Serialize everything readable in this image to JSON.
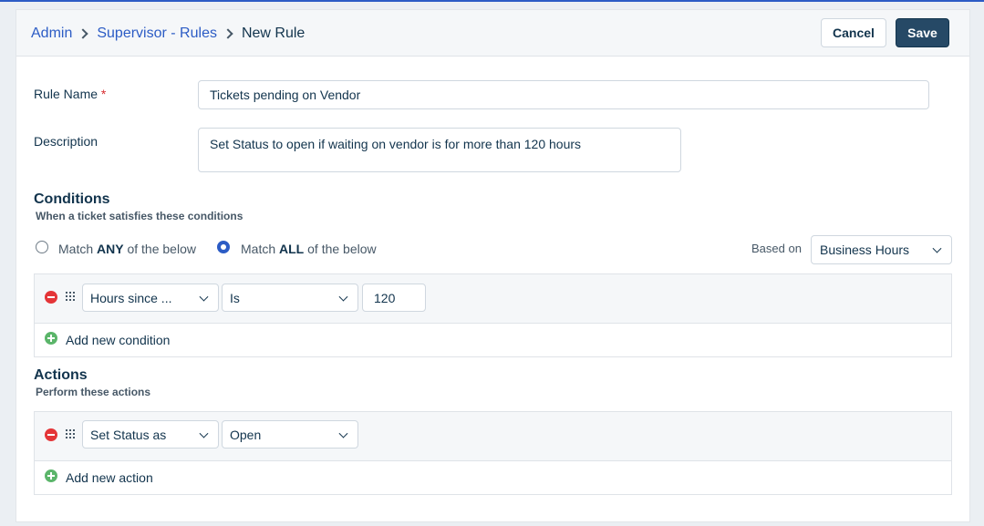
{
  "breadcrumb": {
    "items": [
      "Admin",
      "Supervisor - Rules"
    ],
    "current": "New Rule"
  },
  "toolbar": {
    "cancel_label": "Cancel",
    "save_label": "Save"
  },
  "form": {
    "rule_name_label": "Rule Name",
    "required_mark": "*",
    "rule_name_value": "Tickets pending on Vendor",
    "description_label": "Description",
    "description_value": "Set Status to open if waiting on vendor is for more than 120 hours"
  },
  "conditions": {
    "title": "Conditions",
    "subtitle": "When a ticket satisfies these conditions",
    "match_any_pre": "Match ",
    "match_any_bold": "ANY",
    "match_any_post": " of the below",
    "match_all_pre": "Match ",
    "match_all_bold": "ALL",
    "match_all_post": " of the below",
    "selected_match": "ALL",
    "based_on_label": "Based on",
    "based_on_value": "Business Hours",
    "rows": [
      {
        "field": "Hours since ...",
        "operator": "Is",
        "value": "120"
      }
    ],
    "add_label": "Add new condition"
  },
  "actions": {
    "title": "Actions",
    "subtitle": "Perform these actions",
    "rows": [
      {
        "action": "Set Status as",
        "value": "Open"
      }
    ],
    "add_label": "Add new action"
  },
  "colors": {
    "accent": "#2c5cc5",
    "primary_button": "#264966",
    "remove": "#e43538",
    "add": "#5bb56a"
  }
}
